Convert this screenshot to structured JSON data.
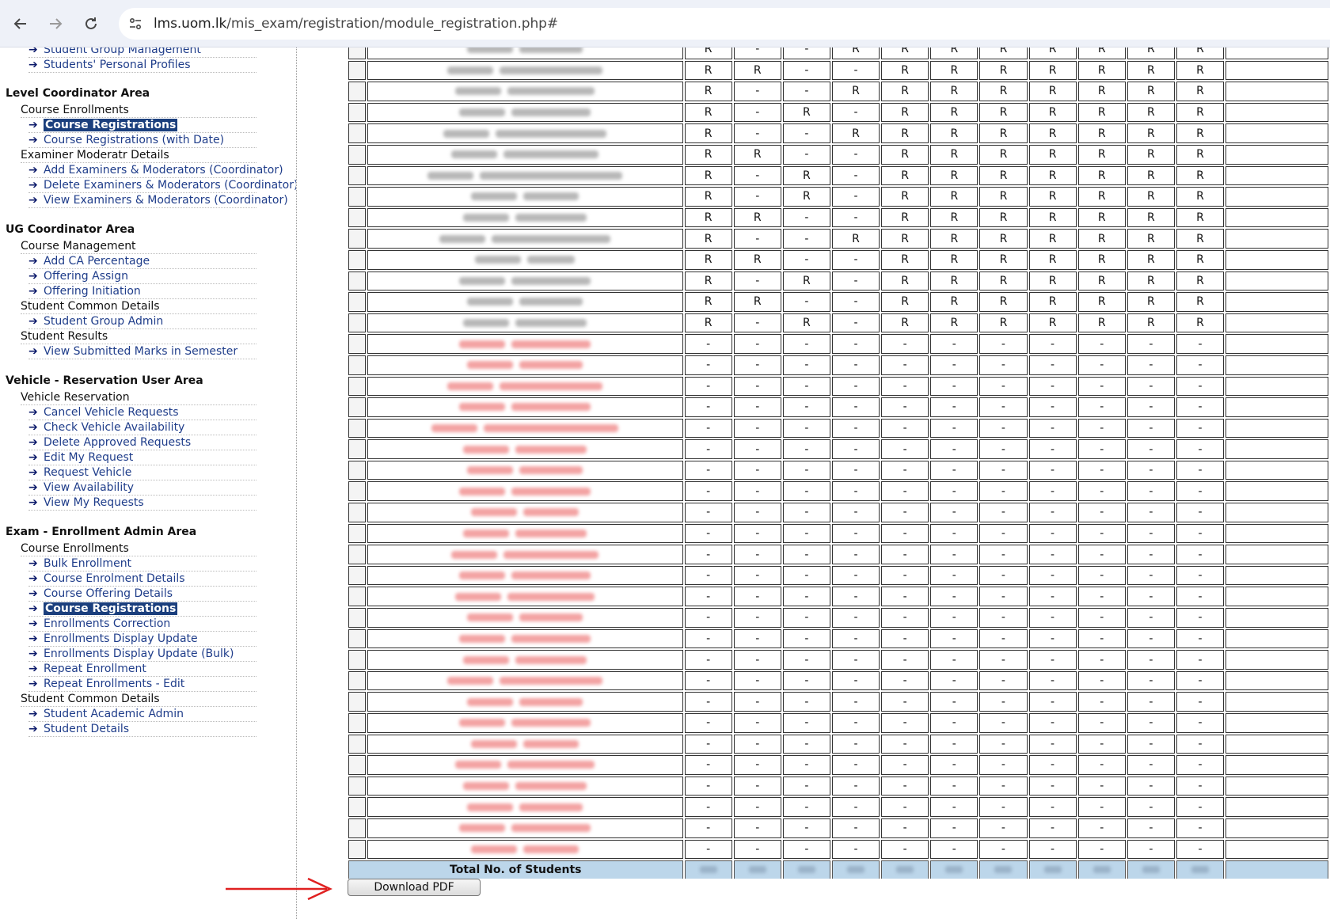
{
  "browser": {
    "url_host": "lms.uom.lk",
    "url_path": "/mis_exam/registration/module_registration.php#"
  },
  "sidebar": {
    "groups": [
      {
        "title": "",
        "items": [
          {
            "type": "link",
            "label": "Student Group Management"
          },
          {
            "type": "link",
            "label": "Students' Personal Profiles"
          }
        ]
      },
      {
        "title": "Level Coordinator Area",
        "items": [
          {
            "type": "cat",
            "label": "Course Enrollments"
          },
          {
            "type": "link",
            "label": "Course Registrations",
            "active": true
          },
          {
            "type": "link",
            "label": "Course Registrations (with Date)"
          },
          {
            "type": "cat",
            "label": "Examiner Moderatr Details"
          },
          {
            "type": "link",
            "label": "Add Examiners & Moderators (Coordinator)"
          },
          {
            "type": "link",
            "label": "Delete Examiners & Moderators (Coordinator)"
          },
          {
            "type": "link",
            "label": "View Examiners & Moderators (Coordinator)"
          }
        ]
      },
      {
        "title": "UG Coordinator Area",
        "items": [
          {
            "type": "cat",
            "label": "Course Management"
          },
          {
            "type": "link",
            "label": "Add CA Percentage"
          },
          {
            "type": "link",
            "label": "Offering Assign"
          },
          {
            "type": "link",
            "label": "Offering Initiation"
          },
          {
            "type": "cat",
            "label": "Student Common Details"
          },
          {
            "type": "link",
            "label": "Student Group Admin"
          },
          {
            "type": "cat",
            "label": "Student Results"
          },
          {
            "type": "link",
            "label": "View Submitted Marks in Semester"
          }
        ]
      },
      {
        "title": "Vehicle - Reservation User Area",
        "items": [
          {
            "type": "cat",
            "label": "Vehicle Reservation"
          },
          {
            "type": "link",
            "label": "Cancel Vehicle Requests"
          },
          {
            "type": "link",
            "label": "Check Vehicle Availability"
          },
          {
            "type": "link",
            "label": "Delete Approved Requests"
          },
          {
            "type": "link",
            "label": "Edit My Request"
          },
          {
            "type": "link",
            "label": "Request Vehicle"
          },
          {
            "type": "link",
            "label": "View Availability"
          },
          {
            "type": "link",
            "label": "View My Requests"
          }
        ]
      },
      {
        "title": "Exam - Enrollment Admin Area",
        "items": [
          {
            "type": "cat",
            "label": "Course Enrollments"
          },
          {
            "type": "link",
            "label": "Bulk Enrollment"
          },
          {
            "type": "link",
            "label": "Course Enrolment Details"
          },
          {
            "type": "link",
            "label": "Course Offering Details"
          },
          {
            "type": "link",
            "label": "Course Registrations",
            "active": true
          },
          {
            "type": "link",
            "label": "Enrollments Correction"
          },
          {
            "type": "link",
            "label": "Enrollments Display Update"
          },
          {
            "type": "link",
            "label": "Enrollments Display Update (Bulk)"
          },
          {
            "type": "link",
            "label": "Repeat Enrollment"
          },
          {
            "type": "link",
            "label": "Repeat Enrollments - Edit"
          },
          {
            "type": "cat",
            "label": "Student Common Details"
          },
          {
            "type": "link",
            "label": "Student Academic Admin"
          },
          {
            "type": "link",
            "label": "Student Details"
          }
        ]
      }
    ]
  },
  "table": {
    "rows_registered": [
      [
        "R",
        "-",
        "-",
        "R",
        "R",
        "R",
        "R",
        "R",
        "R",
        "R",
        "R"
      ],
      [
        "R",
        "R",
        "-",
        "-",
        "R",
        "R",
        "R",
        "R",
        "R",
        "R",
        "R"
      ],
      [
        "R",
        "-",
        "-",
        "R",
        "R",
        "R",
        "R",
        "R",
        "R",
        "R",
        "R"
      ],
      [
        "R",
        "-",
        "R",
        "-",
        "R",
        "R",
        "R",
        "R",
        "R",
        "R",
        "R"
      ],
      [
        "R",
        "-",
        "-",
        "R",
        "R",
        "R",
        "R",
        "R",
        "R",
        "R",
        "R"
      ],
      [
        "R",
        "R",
        "-",
        "-",
        "R",
        "R",
        "R",
        "R",
        "R",
        "R",
        "R"
      ],
      [
        "R",
        "-",
        "R",
        "-",
        "R",
        "R",
        "R",
        "R",
        "R",
        "R",
        "R"
      ],
      [
        "R",
        "-",
        "R",
        "-",
        "R",
        "R",
        "R",
        "R",
        "R",
        "R",
        "R"
      ],
      [
        "R",
        "R",
        "-",
        "-",
        "R",
        "R",
        "R",
        "R",
        "R",
        "R",
        "R"
      ],
      [
        "R",
        "-",
        "-",
        "R",
        "R",
        "R",
        "R",
        "R",
        "R",
        "R",
        "R"
      ],
      [
        "R",
        "R",
        "-",
        "-",
        "R",
        "R",
        "R",
        "R",
        "R",
        "R",
        "R"
      ],
      [
        "R",
        "-",
        "R",
        "-",
        "R",
        "R",
        "R",
        "R",
        "R",
        "R",
        "R"
      ],
      [
        "R",
        "R",
        "-",
        "-",
        "R",
        "R",
        "R",
        "R",
        "R",
        "R",
        "R"
      ],
      [
        "R",
        "-",
        "R",
        "-",
        "R",
        "R",
        "R",
        "R",
        "R",
        "R",
        "R"
      ]
    ],
    "empty_row_count": 25,
    "empty_value": "-",
    "total_label": "Total No. of Students"
  },
  "download_button": "Download PDF",
  "colors": {
    "accent_active": "#1b3f7d",
    "link": "#1f3d8a",
    "total_row_bg": "#bcd6ea",
    "annotation_arrow": "#e02020"
  },
  "icons": [
    "back-arrow-icon",
    "forward-arrow-icon",
    "reload-icon",
    "site-info-icon",
    "arrow-right-icon"
  ]
}
